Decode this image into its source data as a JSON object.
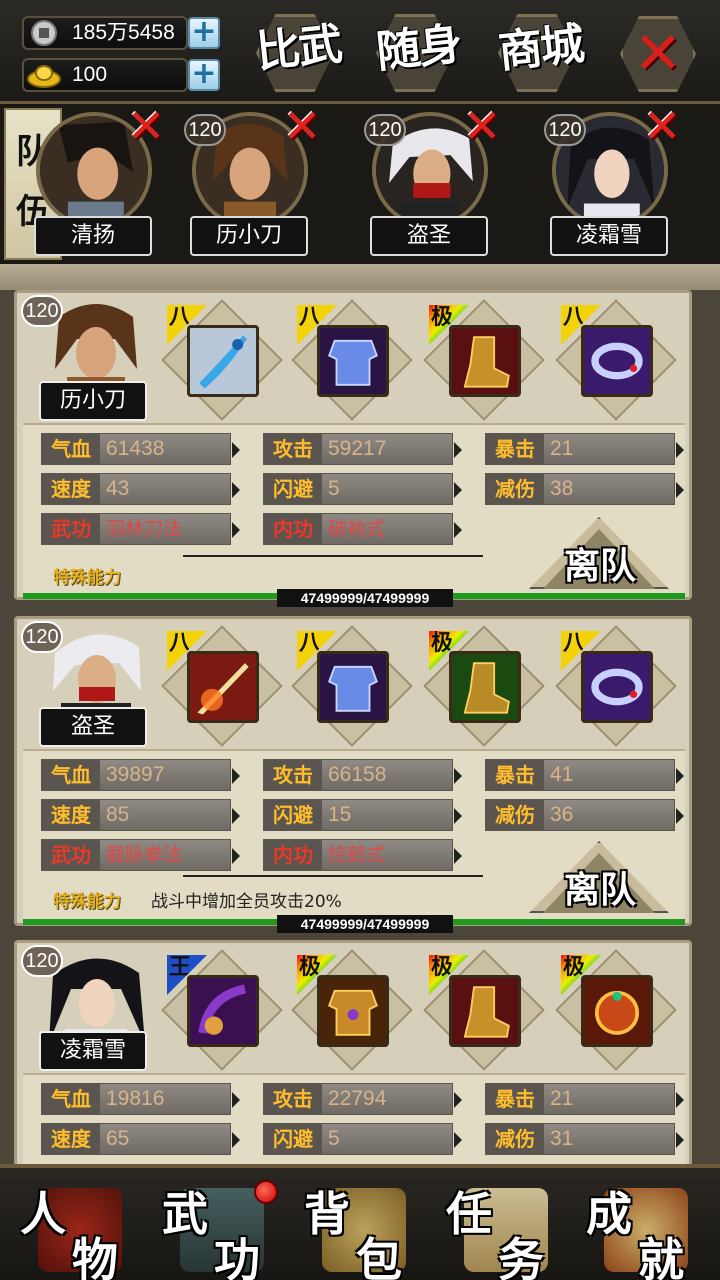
{
  "currency": {
    "silver": "185万5458",
    "gold": "100"
  },
  "top_menu": {
    "arena": "比武",
    "carry": "随身",
    "shop": "商城",
    "close": "✕"
  },
  "team": {
    "tab_label_1": "队",
    "tab_label_2": "伍",
    "members": [
      {
        "name": "清扬",
        "level": ""
      },
      {
        "name": "历小刀",
        "level": "120"
      },
      {
        "name": "盗圣",
        "level": "120"
      },
      {
        "name": "凌霜雪",
        "level": "120"
      }
    ]
  },
  "labels": {
    "hp": "气血",
    "attack": "攻击",
    "crit": "暴击",
    "speed": "速度",
    "dodge": "闪避",
    "reduce": "减伤",
    "martial": "武功",
    "inner": "内功",
    "special": "特殊能力",
    "leave": "离队"
  },
  "heroes": [
    {
      "name": "历小刀",
      "level": "120",
      "equip_grades": [
        "八",
        "八",
        "极",
        "八"
      ],
      "hp": "61438",
      "attack": "59217",
      "crit": "21",
      "speed": "43",
      "dodge": "5",
      "reduce": "38",
      "martial": "羽林刀法",
      "inner": "破衲式",
      "special": "",
      "hp_text": "47499999/47499999"
    },
    {
      "name": "盗圣",
      "level": "120",
      "equip_grades": [
        "八",
        "八",
        "极",
        "八"
      ],
      "hp": "39897",
      "attack": "66158",
      "crit": "41",
      "speed": "85",
      "dodge": "15",
      "reduce": "36",
      "martial": "截脉拳法",
      "inner": "控鹤式",
      "special": "战斗中增加全员攻击20%",
      "hp_text": "47499999/47499999"
    },
    {
      "name": "凌霜雪",
      "level": "120",
      "equip_grades": [
        "王",
        "极",
        "极",
        "极"
      ],
      "hp": "19816",
      "attack": "22794",
      "crit": "21",
      "speed": "65",
      "dodge": "5",
      "reduce": "31"
    }
  ],
  "bottom_nav": [
    {
      "l1": "人",
      "l2": "物"
    },
    {
      "l1": "武",
      "l2": "功"
    },
    {
      "l1": "背",
      "l2": "包"
    },
    {
      "l1": "任",
      "l2": "务"
    },
    {
      "l1": "成",
      "l2": "就"
    }
  ],
  "colors": {
    "stat_key": "#ffbd2e",
    "skill_key": "#e8392a",
    "hp_bar": "#1e9a1e",
    "remove_x": "#e0201c"
  }
}
